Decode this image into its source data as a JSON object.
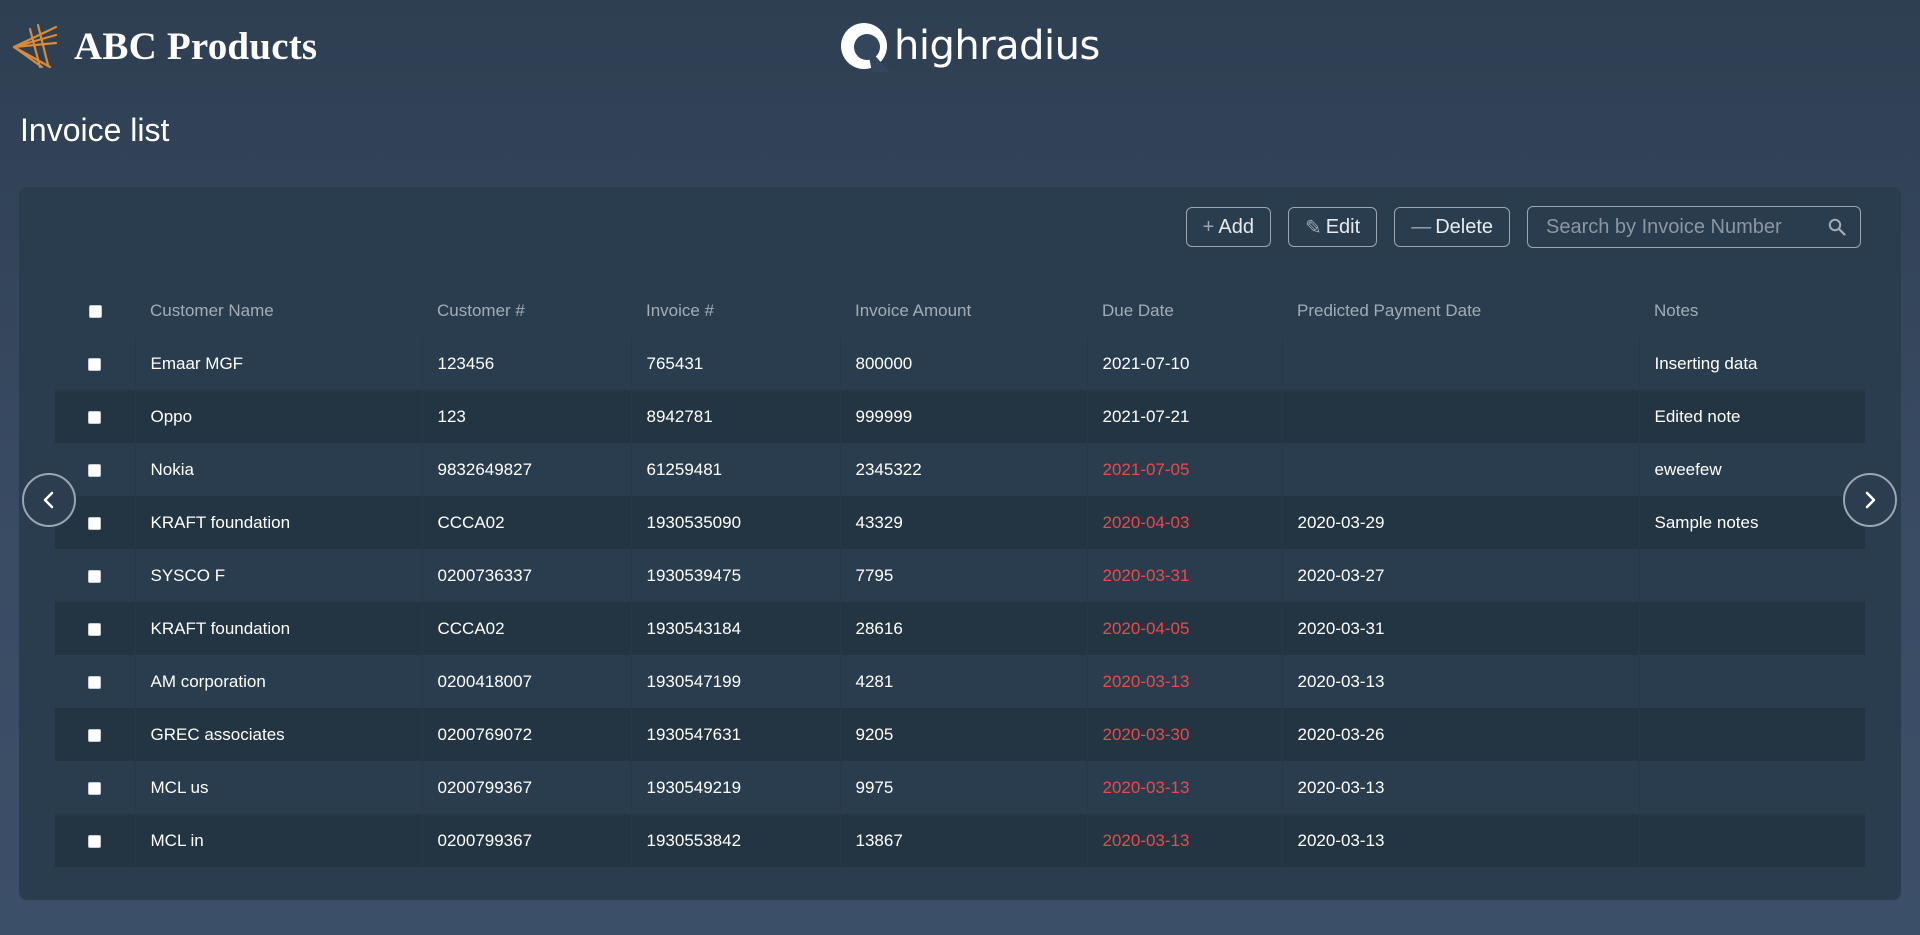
{
  "header": {
    "brand_name": "ABC Products",
    "partner_name": "highradius",
    "page_title": "Invoice list"
  },
  "toolbar": {
    "add_label": "Add",
    "edit_label": "Edit",
    "delete_label": "Delete",
    "search_placeholder": "Search by Invoice Number"
  },
  "table": {
    "columns": [
      "Customer Name",
      "Customer #",
      "Invoice #",
      "Invoice Amount",
      "Due Date",
      "Predicted Payment Date",
      "Notes"
    ],
    "rows": [
      {
        "customer_name": "Emaar MGF",
        "customer_no": "123456",
        "invoice_no": "765431",
        "amount": "800000",
        "due_date": "2021-07-10",
        "overdue": false,
        "predicted_date": "",
        "notes": "Inserting data"
      },
      {
        "customer_name": "Oppo",
        "customer_no": "123",
        "invoice_no": "8942781",
        "amount": "999999",
        "due_date": "2021-07-21",
        "overdue": false,
        "predicted_date": "",
        "notes": "Edited note"
      },
      {
        "customer_name": "Nokia",
        "customer_no": "9832649827",
        "invoice_no": "61259481",
        "amount": "2345322",
        "due_date": "2021-07-05",
        "overdue": true,
        "predicted_date": "",
        "notes": "eweefew"
      },
      {
        "customer_name": "KRAFT foundation",
        "customer_no": "CCCA02",
        "invoice_no": "1930535090",
        "amount": "43329",
        "due_date": "2020-04-03",
        "overdue": true,
        "predicted_date": "2020-03-29",
        "notes": "Sample notes"
      },
      {
        "customer_name": "SYSCO F",
        "customer_no": "0200736337",
        "invoice_no": "1930539475",
        "amount": "7795",
        "due_date": "2020-03-31",
        "overdue": true,
        "predicted_date": "2020-03-27",
        "notes": ""
      },
      {
        "customer_name": "KRAFT foundation",
        "customer_no": "CCCA02",
        "invoice_no": "1930543184",
        "amount": "28616",
        "due_date": "2020-04-05",
        "overdue": true,
        "predicted_date": "2020-03-31",
        "notes": ""
      },
      {
        "customer_name": "AM corporation",
        "customer_no": "0200418007",
        "invoice_no": "1930547199",
        "amount": "4281",
        "due_date": "2020-03-13",
        "overdue": true,
        "predicted_date": "2020-03-13",
        "notes": ""
      },
      {
        "customer_name": "GREC associates",
        "customer_no": "0200769072",
        "invoice_no": "1930547631",
        "amount": "9205",
        "due_date": "2020-03-30",
        "overdue": true,
        "predicted_date": "2020-03-26",
        "notes": ""
      },
      {
        "customer_name": "MCL us",
        "customer_no": "0200799367",
        "invoice_no": "1930549219",
        "amount": "9975",
        "due_date": "2020-03-13",
        "overdue": true,
        "predicted_date": "2020-03-13",
        "notes": ""
      },
      {
        "customer_name": "MCL in",
        "customer_no": "0200799367",
        "invoice_no": "1930553842",
        "amount": "13867",
        "due_date": "2020-03-13",
        "overdue": true,
        "predicted_date": "2020-03-13",
        "notes": ""
      }
    ]
  },
  "colors": {
    "background": "#3a4c64",
    "panel": "#2a3d4e",
    "row_alt": "#233442",
    "overdue": "#ea4a4a",
    "brand_accent": "#d98a3a"
  },
  "icons": {
    "brand": "abc-products-logo",
    "partner": "highradius-logo-icon",
    "add": "plus-icon",
    "edit": "pencil-icon",
    "delete": "minus-icon",
    "search": "search-icon",
    "prev": "chevron-left-icon",
    "next": "chevron-right-icon"
  }
}
